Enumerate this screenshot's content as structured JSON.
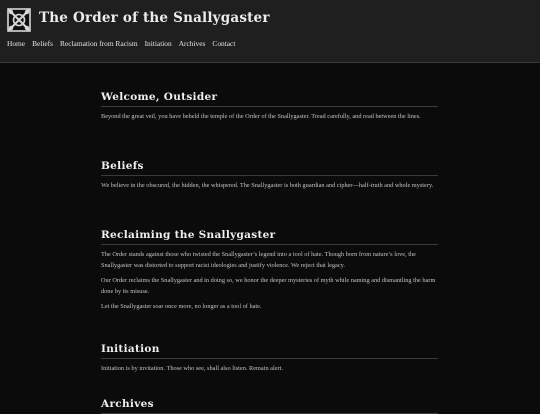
{
  "site": {
    "title": "The Order of the Snallygaster",
    "logo_icon": "sigil-knot-icon"
  },
  "nav": [
    {
      "label": "Home"
    },
    {
      "label": "Beliefs"
    },
    {
      "label": "Reclamation from Racism"
    },
    {
      "label": "Initiation"
    },
    {
      "label": "Archives"
    },
    {
      "label": "Contact"
    }
  ],
  "sections": {
    "welcome": {
      "title": "Welcome, Outsider",
      "paragraphs": [
        "Beyond the great veil, you have beheld the temple of the Order of the Snallygaster. Tread carefully, and read between the lines."
      ]
    },
    "beliefs": {
      "title": "Beliefs",
      "paragraphs": [
        "We believe in the obscured, the hidden, the whispered. The Snallygaster is both guardian and cipher—half-truth and whole mystery."
      ]
    },
    "reclaiming": {
      "title": "Reclaiming the Snallygaster",
      "paragraphs": [
        "The Order stands against those who twisted the Snallygaster’s legend into a tool of hate. Though born from nature’s love, the Snallygaster was distorted to support racist ideologies and justify violence. We reject that legacy.",
        "Our Order reclaims the Snallygaster and in doing so, we honor the deeper mysteries of myth while naming and dismantling the harm done by its misuse.",
        "Let the Snallygaster soar once more, no longer as a tool of hate."
      ]
    },
    "initiation": {
      "title": "Initiation",
      "paragraphs": [
        "Initiation is by invitation. Those who see, shall also listen. Remain alert."
      ]
    },
    "archives": {
      "title": "Archives"
    }
  }
}
